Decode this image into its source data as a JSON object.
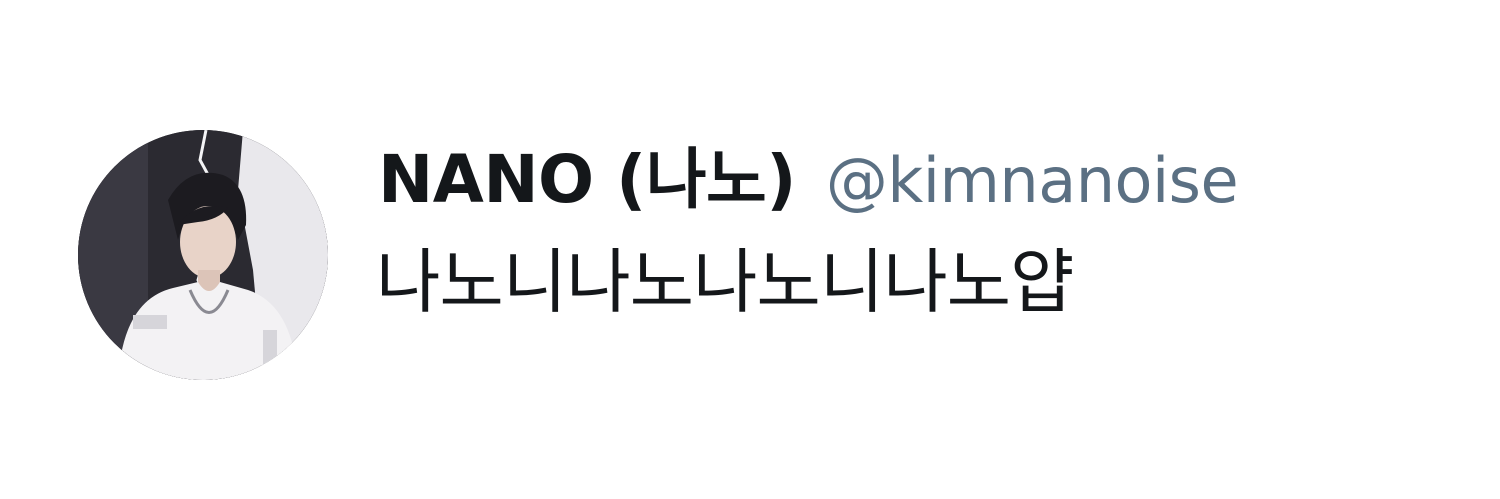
{
  "profile": {
    "display_name": "NANO (나노)",
    "handle": "@kimnanoise",
    "bio": "나노니나노나노니나노얍",
    "avatar_icon": "avatar-photo"
  },
  "colors": {
    "name": "#14171a",
    "handle": "#5b7083",
    "background": "#ffffff"
  }
}
